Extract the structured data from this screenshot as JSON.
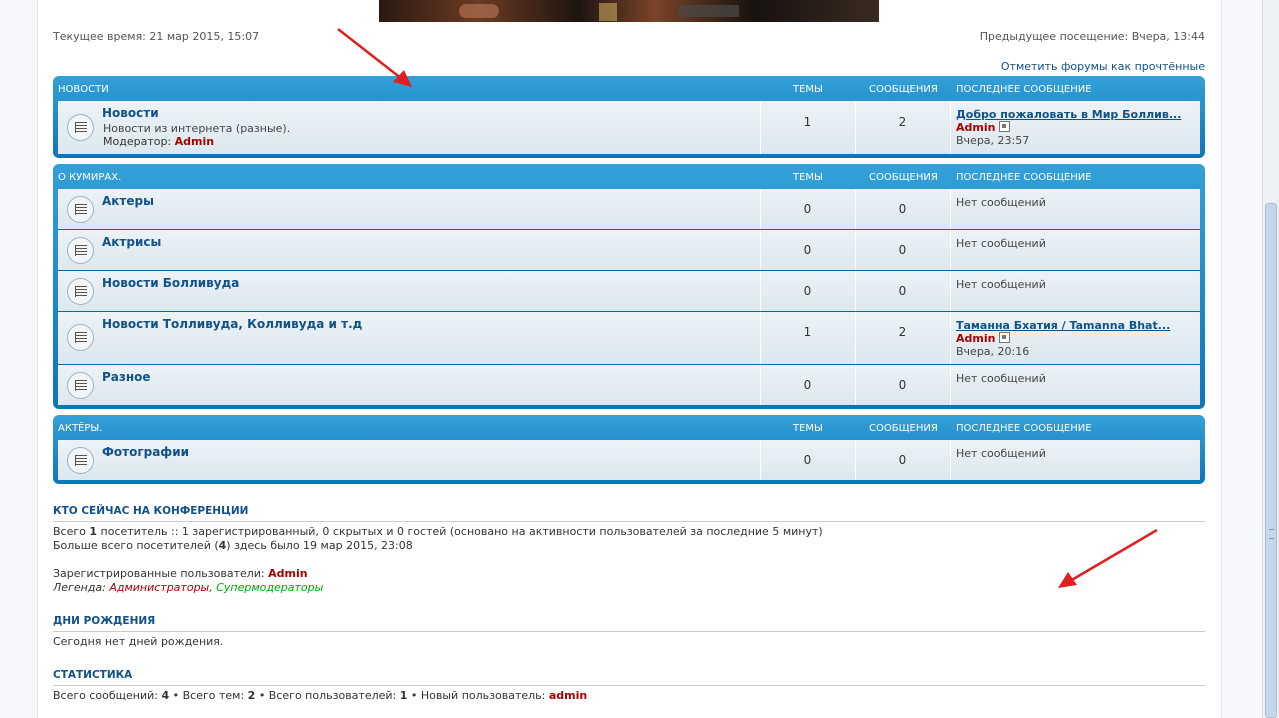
{
  "header": {
    "current_time": "Текущее время: 21 мар 2015, 15:07",
    "last_visit": "Предыдущее посещение: Вчера, 13:44",
    "mark_read": "Отметить форумы как прочтённые"
  },
  "columns": {
    "topics": "ТЕМЫ",
    "posts": "СООБЩЕНИЯ",
    "last_post": "ПОСЛЕДНЕЕ СООБЩЕНИЕ"
  },
  "categories": [
    {
      "title": "НОВОСТИ",
      "forums": [
        {
          "name": "Новости",
          "desc": "Новости из интернета (разные).",
          "moderator_label": "Модератор:",
          "moderator": "Admin",
          "topics": "1",
          "posts": "2",
          "last_title": "Добро пожаловать в Мир Боллив...",
          "last_author": "Admin",
          "last_time": "Вчера, 23:57"
        }
      ]
    },
    {
      "title": "О КУМИРАХ.",
      "forums": [
        {
          "name": "Актеры",
          "topics": "0",
          "posts": "0",
          "last_none": "Нет сообщений"
        },
        {
          "name": "Актрисы",
          "topics": "0",
          "posts": "0",
          "last_none": "Нет сообщений"
        },
        {
          "name": "Новости Болливуда",
          "topics": "0",
          "posts": "0",
          "last_none": "Нет сообщений"
        },
        {
          "name": "Новости Толливуда, Колливуда и т.д",
          "topics": "1",
          "posts": "2",
          "last_title": "Таманна Бхатия / Tamanna Bhat...",
          "last_author": "Admin",
          "last_time": "Вчера, 20:16"
        },
        {
          "name": "Разное",
          "topics": "0",
          "posts": "0",
          "last_none": "Нет сообщений"
        }
      ]
    },
    {
      "title": "АКТЁРЫ.",
      "forums": [
        {
          "name": "Фотографии",
          "topics": "0",
          "posts": "0",
          "last_none": "Нет сообщений"
        }
      ]
    }
  ],
  "online": {
    "title": "КТО СЕЙЧАС НА КОНФЕРЕНЦИИ",
    "line1_a": "Всего ",
    "line1_count": "1",
    "line1_b": " посетитель :: 1 зарегистрированный, 0 скрытых и 0 гостей (основано на активности пользователей за последние 5 минут)",
    "line2_a": "Больше всего посетителей (",
    "line2_count": "4",
    "line2_b": ") здесь было 19 мар 2015, 23:08",
    "registered_label": "Зарегистрированные пользователи: ",
    "registered_user": "Admin",
    "legend_label": "Легенда: ",
    "legend_admins": "Администраторы",
    "legend_sep": ", ",
    "legend_mods": "Супермодераторы"
  },
  "birthdays": {
    "title": "ДНИ РОЖДЕНИЯ",
    "text": "Сегодня нет дней рождения."
  },
  "stats": {
    "title": "СТАТИСТИКА",
    "posts_label": "Всего сообщений: ",
    "posts": "4",
    "topics_label": " • Всего тем: ",
    "topics": "2",
    "users_label": " • Всего пользователей: ",
    "users": "1",
    "newest_label": " • Новый пользователь: ",
    "newest": "admin"
  },
  "colors": {
    "accent": "#105289",
    "header_blue": "#0f85c7",
    "admin": "#aa0000",
    "mod": "#00aa00",
    "arrow": "#e02020"
  }
}
